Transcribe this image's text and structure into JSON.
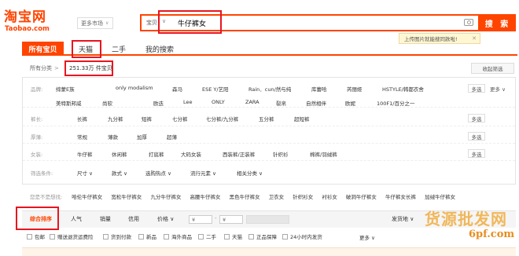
{
  "header": {
    "logo_cn": "淘宝网",
    "logo_en": "Taobao.com",
    "market_label": "更多市场",
    "search_type": "宝贝",
    "search_query": "牛仔裤女",
    "search_button": "搜 索",
    "tip": "上传图片就能搜同款啦!"
  },
  "tabs": [
    "所有宝贝",
    "天猫",
    "二手",
    "我的搜索"
  ],
  "category": {
    "label": "所有分类",
    "sep": ">",
    "count": "251.33万 件宝贝",
    "collapse": "收起筛选"
  },
  "filters": {
    "brand": {
      "label": "品牌:",
      "row1": [
        "缔蒙E族",
        "only modalism",
        "森马",
        "ESE Y/艺阳",
        "Rain．cun/然与纯",
        "库蕾哈",
        "芮丽娅",
        "HSTYLE/韩都衣舍"
      ],
      "row2": [
        "美特斯邦威",
        "尚软",
        "欧迭",
        "Lee",
        "ONLY",
        "ZARA",
        "裂帛",
        "自然相伴",
        "欧妮",
        "100F1/百分之一"
      ],
      "multi": "多选",
      "more": "更多"
    },
    "length": {
      "label": "裤长:",
      "options": [
        "长裤",
        "九分裤",
        "短裤",
        "七分裤",
        "七分裤/九分裤",
        "五分裤",
        "超短裤"
      ],
      "multi": "多选"
    },
    "thickness": {
      "label": "厚薄:",
      "options": [
        "常规",
        "薄款",
        "加厚",
        "超薄"
      ],
      "multi": "多选"
    },
    "women": {
      "label": "女装:",
      "options": [
        "牛仔裤",
        "休闲裤",
        "打底裤",
        "大码女装",
        "西装裤/正装裤",
        "针织衫",
        "棉裤/羽绒裤"
      ],
      "multi": "多选"
    },
    "conditions": {
      "label": "筛选条件:",
      "options": [
        "尺寸",
        "款式",
        "选购热点",
        "流行元素",
        "相关分类"
      ]
    }
  },
  "related": {
    "label": "您是不是想找:",
    "items": [
      "哈伦牛仔裤女",
      "宽松牛仔裤女",
      "九分牛仔裤女",
      "高腰牛仔裤女",
      "黑色牛仔裤女",
      "卫衣女",
      "针织衫女",
      "衬衫女",
      "破洞牛仔裤女",
      "牛仔裤女长裤",
      "加绒牛仔裤女"
    ]
  },
  "sort": {
    "items": [
      "综合排序",
      "人气",
      "销量",
      "信用",
      "价格"
    ],
    "price_from": "¥",
    "price_to": "¥",
    "ship_to": "发货地"
  },
  "checks": {
    "items": [
      "包邮",
      "赠送退货运费险",
      "货到付款",
      "新品",
      "海外商品",
      "二手",
      "天猫",
      "正品保障",
      "24小时内发货"
    ],
    "more": "更多"
  },
  "watermark": {
    "line1": "货源批发网",
    "line2": "6pf.com"
  }
}
